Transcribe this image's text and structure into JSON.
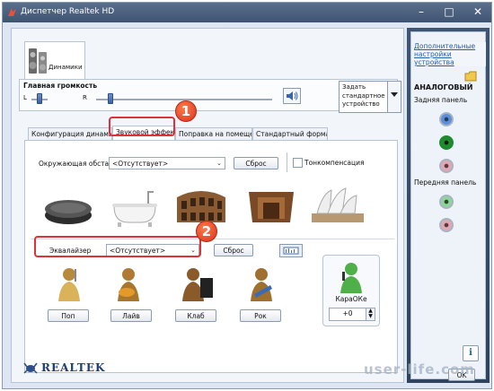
{
  "window": {
    "title": "Диспетчер Realtek HD"
  },
  "device_tab": {
    "label": "Динамики"
  },
  "volume": {
    "title": "Главная громкость",
    "left": "L",
    "right": "R",
    "balance_level": 0.5,
    "volume_level": 0.08
  },
  "default_device": {
    "label": "Задать стандартное устройство"
  },
  "tabs": [
    {
      "label": "Конфигурация динамиков"
    },
    {
      "label": "Звуковой эффект"
    },
    {
      "label": "Поправка на помещение"
    },
    {
      "label": "Стандартный формат"
    }
  ],
  "environment": {
    "label": "Окружающая обста...",
    "value": "<Отсутствует>",
    "reset": "Сброс",
    "tone_comp": "Тонкомпенсация"
  },
  "environments": [
    "stone",
    "bathroom",
    "colosseum",
    "hall",
    "opera"
  ],
  "equalizer": {
    "label": "Эквалайзер",
    "value": "<Отсутствует>",
    "reset": "Сброс"
  },
  "presets": [
    {
      "label": "Поп"
    },
    {
      "label": "Лайв"
    },
    {
      "label": "Клаб"
    },
    {
      "label": "Рок"
    }
  ],
  "karaoke": {
    "label": "КараОКе",
    "value": "+0"
  },
  "sidebar": {
    "link": "Дополнительные настройки устройства",
    "analog": "АНАЛОГОВЫЙ",
    "rear": "Задняя панель",
    "front": "Передняя панель"
  },
  "brand": "REALTEK",
  "ok_label": "OK",
  "watermark": "user-life.com",
  "badges": [
    "1",
    "2"
  ],
  "colors": {
    "title_bar": "#4a5f7d",
    "highlight": "#e0303a",
    "jack_blue": "#5b8fd9",
    "jack_green": "#1f8a2e",
    "jack_pink": "#e0a8b0"
  }
}
